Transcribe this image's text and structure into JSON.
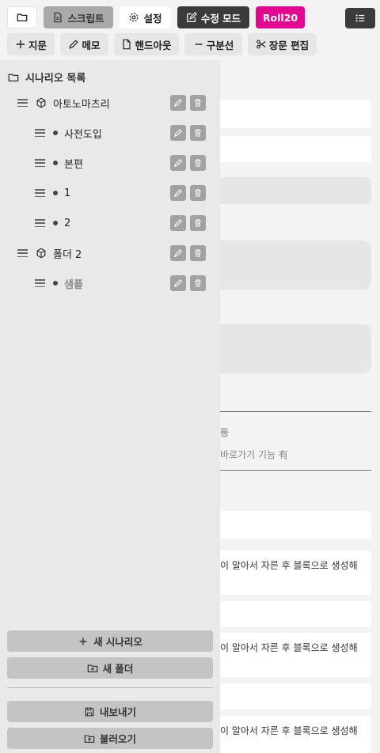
{
  "toolbar": {
    "script_label": "스크립트",
    "settings_label": "설정",
    "edit_mode_label": "수정 모드",
    "roll20_label": "Roll20",
    "colors": {
      "roll20": "#e3088f",
      "dark": "#3b3b3b"
    }
  },
  "insert_bar": {
    "narration_label": "지문",
    "memo_label": "메모",
    "handout_label": "핸드아웃",
    "divider_label": "구분선",
    "scene_edit_label": "장문 편집"
  },
  "sidebar": {
    "title": "시나리오 목록",
    "tree": [
      {
        "type": "folder",
        "label": "아토노마츠리",
        "level": 0
      },
      {
        "type": "scenario",
        "label": "사전도입",
        "level": 1
      },
      {
        "type": "scenario",
        "label": "본편",
        "level": 1
      },
      {
        "type": "scenario",
        "label": "1",
        "level": 1
      },
      {
        "type": "scenario",
        "label": "2",
        "level": 1
      },
      {
        "type": "folder",
        "label": "폴더 2",
        "level": 0
      },
      {
        "type": "scenario",
        "label": "샘플",
        "level": 1,
        "muted": true
      }
    ],
    "new_scenario_label": "새 시나리오",
    "new_folder_label": "새 폴더",
    "export_label": "내보내기",
    "import_label": "불러오기"
  },
  "main": {
    "fragment_1": "등",
    "fragment_2": "바로가기 기능 有",
    "block_text_a": "이 알아서 자른 후 블록으로 생성해",
    "block_text_b": "이 알아서 자른 후 블록으로 생성해",
    "block_text_c": "이 알아서 자른 후 블록으로 생성해"
  }
}
